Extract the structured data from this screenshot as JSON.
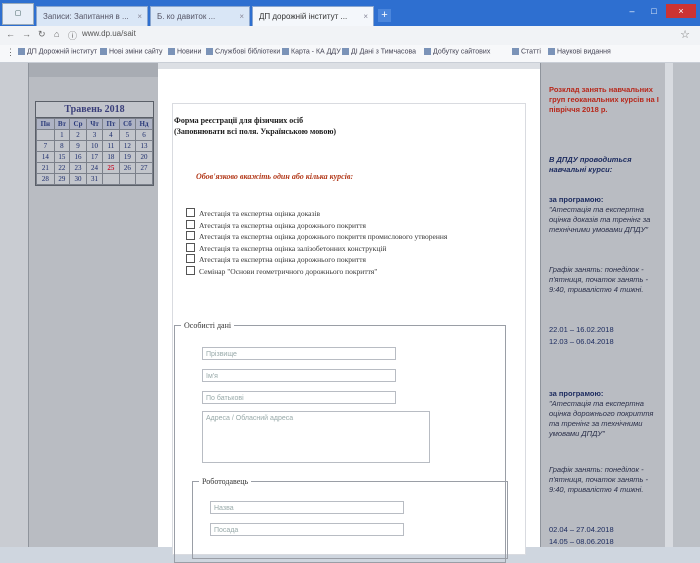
{
  "browser": {
    "tabs": [
      {
        "label": "Записи: Запитання в ...",
        "active": false
      },
      {
        "label": "Б. ко давиток ...",
        "active": false
      },
      {
        "label": "ДП дорожній інститут ...",
        "active": true
      }
    ],
    "url": "www.dp.ua/sait",
    "bookmarks": [
      "ДП Дорожній інститут",
      "Нові зміни сайту",
      "Новини",
      "Службові бібліотеки",
      "Карта - КА ДДУ",
      "ДІ Дані з Тимчасова",
      "Добутку сайтових",
      "Статті",
      "Наукові видання"
    ]
  },
  "calendar": {
    "title": "Травень 2018",
    "days": [
      "Пн",
      "Вт",
      "Ср",
      "Чт",
      "Пт",
      "Сб",
      "Нд"
    ],
    "weeks": [
      [
        "",
        "1",
        "2",
        "3",
        "4",
        "5",
        "6"
      ],
      [
        "7",
        "8",
        "9",
        "10",
        "11",
        "12",
        "13"
      ],
      [
        "14",
        "15",
        "16",
        "17",
        "18",
        "19",
        "20"
      ],
      [
        "21",
        "22",
        "23",
        "24",
        "25",
        "26",
        "27"
      ],
      [
        "28",
        "29",
        "30",
        "31",
        "",
        "",
        ""
      ]
    ]
  },
  "form": {
    "title": "Форма реєстрації для фізичних осіб",
    "subtitle": "(Заповнювати всі поля. Українською мовою)",
    "required_note": "Обов'язково вкажіть один або кілька курсів:",
    "courses": [
      "Атестація та експертна оцінка доказів",
      "Атестація та експертна оцінка дорожнього покриття",
      "Атестація та експертна оцінка дорожнього покриття промислового утворення",
      "Атестація та експертна оцінка залізобетонних конструкцій",
      "Атестація та експертна оцінка дорожнього покриття",
      "Семінар \"Основи геометричного дорожнього покриття\""
    ],
    "personal_legend": "Особисті дані",
    "fields": {
      "surname": "Прізвище",
      "name": "Ім'я",
      "patronymic": "По батькові",
      "address": "Адреса / Обласний адреса"
    },
    "employer_legend": "Роботодавець",
    "employer_fields": {
      "company": "Назва",
      "position": "Посада"
    }
  },
  "sidebar_right": {
    "schedule_header": "Розклад занять навчальних груп геоканальних курсів на І півріччя 2018 р.",
    "intro": "В ДПДУ проводиться навчальні курси:",
    "program1_label": "за програмою:",
    "program1": "\"Атестація та експертна оцінка доказів та тренінг за технічними умовами ДПДУ\"",
    "schedule1_note": "Графік занять: понеділок - п'ятниця, початок занять - 9:40, тривалістю 4 тижні.",
    "dates1": [
      "22.01 – 16.02.2018",
      "12.03 – 06.04.2018"
    ],
    "program2_label": "за програмою:",
    "program2": "\"Атестація та експертна оцінка дорожнього покриття та тренінг за технічними умовами ДПДУ\"",
    "schedule2_note": "Графік занять: понеділок - п'ятниця, початок занять - 9:40, тривалістю 4 тижні.",
    "dates2": [
      "02.04 – 27.04.2018",
      "14.05 – 08.06.2018"
    ]
  },
  "colors": {
    "accent_red": "#b8281b",
    "navy": "#1b2a5e",
    "titlebar": "#2e6fd0"
  }
}
